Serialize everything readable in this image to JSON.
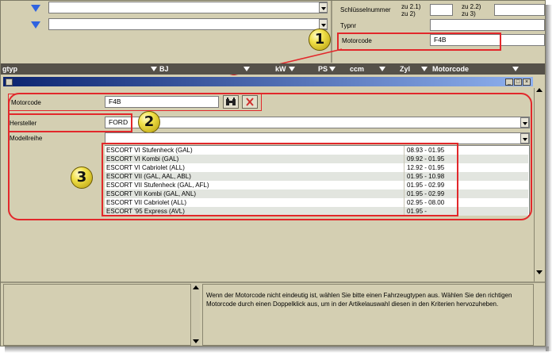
{
  "top": {
    "schluesselnummer_label": "Schlüsselnummer",
    "zu1_label_a": "zu 2.1)",
    "zu1_label_b": "zu 2)",
    "zu2_label_a": "zu 2.2)",
    "zu2_label_b": "zu 3)",
    "typnr_label": "Typnr",
    "motorcode_label": "Motorcode",
    "motorcode_value": "F4B"
  },
  "columns": [
    "gtyp",
    "BJ",
    "kW",
    "PS",
    "ccm",
    "Zyl",
    "Motorcode"
  ],
  "form": {
    "motorcode_label": "Motorcode",
    "motorcode_value": "F4B",
    "hersteller_label": "Hersteller",
    "hersteller_value": "FORD",
    "modellreihe_label": "Modellreihe",
    "modellreihe_value": ""
  },
  "models": [
    {
      "name": "ESCORT VI Stufenheck (GAL)",
      "years": "08.93 - 01.95"
    },
    {
      "name": "ESCORT VI Kombi (GAL)",
      "years": "09.92 - 01.95"
    },
    {
      "name": "ESCORT VI Cabriolet (ALL)",
      "years": "12.92 - 01.95"
    },
    {
      "name": "ESCORT VII (GAL, AAL, ABL)",
      "years": "01.95 - 10.98"
    },
    {
      "name": "ESCORT VII Stufenheck (GAL, AFL)",
      "years": "01.95 - 02.99"
    },
    {
      "name": "ESCORT VII Kombi (GAL, ANL)",
      "years": "01.95 - 02.99"
    },
    {
      "name": "ESCORT VII Cabriolet (ALL)",
      "years": "02.95 - 08.00"
    },
    {
      "name": "ESCORT '95 Express (AVL)",
      "years": "01.95 -"
    }
  ],
  "badges": [
    "1",
    "2",
    "3"
  ],
  "info_text": "Wenn der Motorcode nicht eindeutig ist, wählen Sie bitte einen Fahrzeugtypen aus. Wählen Sie den richtigen Motorcode durch einen Doppelklick aus, um in der Artikelauswahl diesen in den Kriterien hervozuheben.",
  "colors": {
    "highlight": "#e2282b",
    "badge": "#f2e24a",
    "filter_icon": "#2f63e0"
  },
  "icons": [
    "filter-icon",
    "dropdown-arrow-icon",
    "binoculars-icon",
    "delete-x-icon",
    "minimize-icon",
    "maximize-icon",
    "close-icon"
  ]
}
